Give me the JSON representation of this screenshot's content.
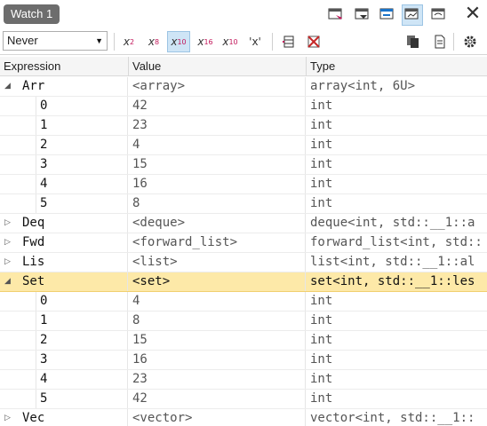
{
  "window": {
    "tab_title": "Watch 1"
  },
  "toolbar": {
    "display_mode": "Never",
    "format_buttons": [
      {
        "base": "x",
        "sub": "2"
      },
      {
        "base": "x",
        "sub": "8"
      },
      {
        "base": "x",
        "sub": "10"
      },
      {
        "base": "x",
        "sub": "16"
      },
      {
        "base": "x",
        "sub": "10"
      },
      {
        "base": "'x'",
        "sub": ""
      }
    ]
  },
  "columns": {
    "expression": "Expression",
    "value": "Value",
    "type": "Type"
  },
  "rows": [
    {
      "expr": "Arr",
      "value": "<array>",
      "type": "array<int, 6U>",
      "level": 0,
      "expanded": true
    },
    {
      "expr": "0",
      "value": "42",
      "type": "int",
      "level": 1
    },
    {
      "expr": "1",
      "value": "23",
      "type": "int",
      "level": 1
    },
    {
      "expr": "2",
      "value": "4",
      "type": "int",
      "level": 1
    },
    {
      "expr": "3",
      "value": "15",
      "type": "int",
      "level": 1
    },
    {
      "expr": "4",
      "value": "16",
      "type": "int",
      "level": 1
    },
    {
      "expr": "5",
      "value": "8",
      "type": "int",
      "level": 1
    },
    {
      "expr": "Deq",
      "value": "<deque>",
      "type": "deque<int, std::__1::a",
      "level": 0,
      "expanded": false
    },
    {
      "expr": "Fwd",
      "value": "<forward_list>",
      "type": "forward_list<int, std::",
      "level": 0,
      "expanded": false
    },
    {
      "expr": "Lis",
      "value": "<list>",
      "type": "list<int, std::__1::al",
      "level": 0,
      "expanded": false
    },
    {
      "expr": "Set",
      "value": "<set>",
      "type": "set<int, std::__1::les",
      "level": 0,
      "expanded": true,
      "selected": true
    },
    {
      "expr": "0",
      "value": "4",
      "type": "int",
      "level": 1
    },
    {
      "expr": "1",
      "value": "8",
      "type": "int",
      "level": 1
    },
    {
      "expr": "2",
      "value": "15",
      "type": "int",
      "level": 1
    },
    {
      "expr": "3",
      "value": "16",
      "type": "int",
      "level": 1
    },
    {
      "expr": "4",
      "value": "23",
      "type": "int",
      "level": 1
    },
    {
      "expr": "5",
      "value": "42",
      "type": "int",
      "level": 1
    },
    {
      "expr": "Vec",
      "value": "<vector>",
      "type": "vector<int, std::__1::",
      "level": 0,
      "expanded": false
    }
  ],
  "colors": {
    "selected_row": "#fde9a8",
    "active_button": "#cfe5f6",
    "tab_bg": "#6d6d6d"
  }
}
